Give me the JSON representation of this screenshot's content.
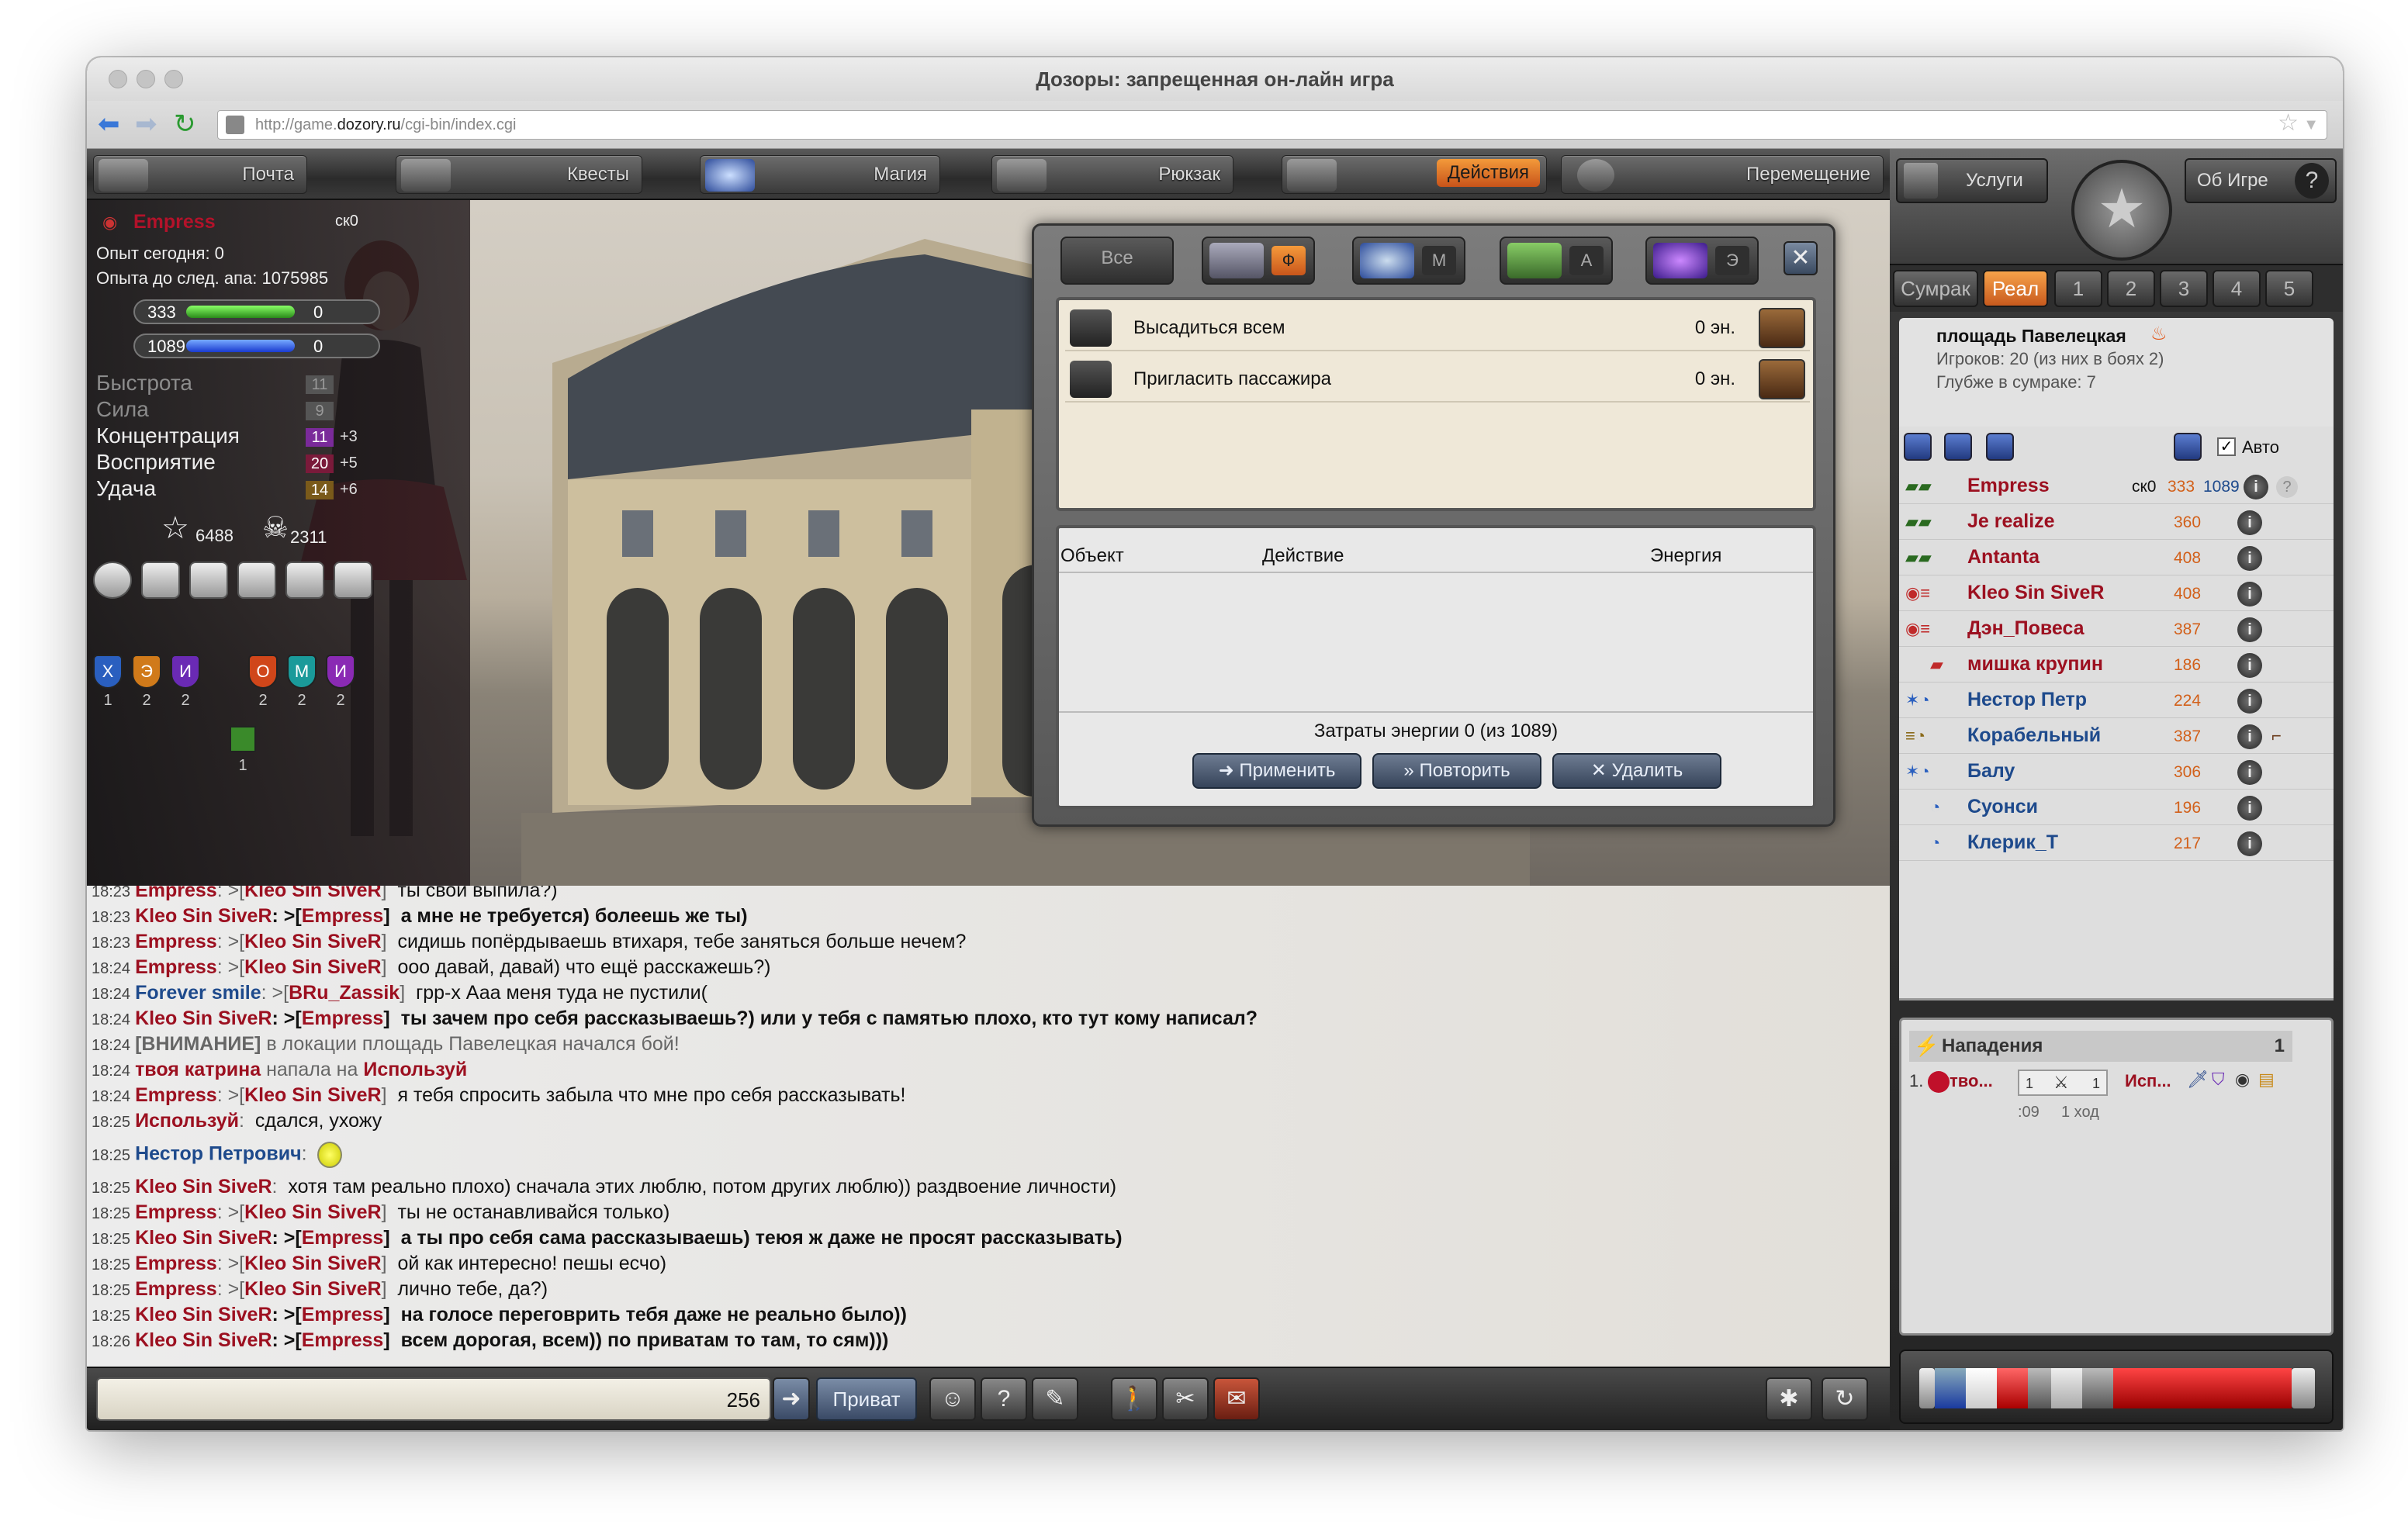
{
  "browser": {
    "title": "Дозоры: запрещенная он-лайн игра",
    "url_prefix": "http://game.",
    "url_domain": "dozory.ru",
    "url_suffix": "/cgi-bin/index.cgi"
  },
  "topnav": [
    {
      "label": "Почта",
      "active": false
    },
    {
      "label": "Квесты",
      "active": false
    },
    {
      "label": "Магия",
      "active": false
    },
    {
      "label": "Рюкзак",
      "active": false
    },
    {
      "label": "Действия",
      "active": true
    },
    {
      "label": "Перемещение",
      "active": false
    }
  ],
  "character": {
    "name": "Empress",
    "tag": "ск0",
    "exp_today": "Опыт сегодня: 0",
    "exp_next": "Опыта до след. апа: 1075985",
    "hp_value": "333",
    "hp_extra": "0",
    "mana_value": "1089",
    "mana_extra": "0",
    "stats": [
      {
        "name": "Быстрота",
        "value": "11",
        "bonus": "",
        "dim": true
      },
      {
        "name": "Сила",
        "value": "9",
        "bonus": "",
        "dim": true
      },
      {
        "name": "Концентрация",
        "value": "11",
        "bonus": "+3",
        "dim": false
      },
      {
        "name": "Восприятие",
        "value": "20",
        "bonus": "+5",
        "dim": false
      },
      {
        "name": "Удача",
        "value": "14",
        "bonus": "+6",
        "dim": false
      }
    ],
    "stars": "6488",
    "skulls": "2311",
    "shields": [
      {
        "letter": "Х",
        "count": "1",
        "color": "#2a5fbf"
      },
      {
        "letter": "Э",
        "count": "2",
        "color": "#d07a1a"
      },
      {
        "letter": "И",
        "count": "2",
        "color": "#6a2ab4"
      },
      {
        "letter": "О",
        "count": "2",
        "color": "#d0461a"
      },
      {
        "letter": "М",
        "count": "2",
        "color": "#1a9a9a"
      },
      {
        "letter": "И",
        "count": "2",
        "color": "#8a2ab4"
      }
    ],
    "extra_badge": "1"
  },
  "dialog": {
    "tabs": [
      {
        "label": "Все",
        "letter": ""
      },
      {
        "label": "",
        "letter": "Ф"
      },
      {
        "label": "",
        "letter": "М"
      },
      {
        "label": "",
        "letter": "А"
      },
      {
        "label": "",
        "letter": "Э"
      }
    ],
    "actions": [
      {
        "text": "Высадиться всем",
        "energy": "0 эн."
      },
      {
        "text": "Пригласить пассажира",
        "energy": "0 эн."
      }
    ],
    "col_object": "Объект",
    "col_action": "Действие",
    "col_energy": "Энергия",
    "cost": "Затраты энергии 0 (из 1089)",
    "btn_apply": "Применить",
    "btn_repeat": "Повторить",
    "btn_delete": "Удалить"
  },
  "chat": [
    {
      "time": "18:23",
      "from": "Empress",
      "from_color": "red",
      "bold": false,
      "private": false,
      "to": "Kleo Sin SiveR",
      "to_color": "red",
      "text": "ты свои выпила?)"
    },
    {
      "time": "18:23",
      "from": "Kleo Sin SiveR",
      "from_color": "red",
      "bold": true,
      "private": true,
      "to": "Empress",
      "to_color": "red",
      "text": "а мне не требуется) болеешь же ты)"
    },
    {
      "time": "18:23",
      "from": "Empress",
      "from_color": "red",
      "bold": false,
      "private": false,
      "to": "Kleo Sin SiveR",
      "to_color": "red",
      "text": "сидишь попёрдываешь втихаря, тебе заняться больше нечем?"
    },
    {
      "time": "18:24",
      "from": "Empress",
      "from_color": "red",
      "bold": false,
      "private": false,
      "to": "Kleo Sin SiveR",
      "to_color": "red",
      "text": "ооо давай, давай) что ещё расскажешь?)"
    },
    {
      "time": "18:24",
      "from": "Forever smile",
      "from_color": "blu",
      "bold": false,
      "private": false,
      "to": "BRu_Zassik",
      "to_color": "red",
      "text": "грр-х Ааа меня туда не пустили("
    },
    {
      "time": "18:24",
      "from": "Kleo Sin SiveR",
      "from_color": "red",
      "bold": true,
      "private": true,
      "to": "Empress",
      "to_color": "red",
      "text": "ты зачем про себя рассказываешь?) или у тебя с памятью плохо, кто тут кому написал?"
    },
    {
      "time": "18:24",
      "system": "[ВНИМАНИЕ]",
      "text": "в локации площадь Павелецкая начался бой!"
    },
    {
      "time": "18:24",
      "attack_a": "твоя катрина",
      "attack_mid": "напала на",
      "attack_b": "Используй"
    },
    {
      "time": "18:24",
      "from": "Empress",
      "from_color": "red",
      "bold": false,
      "private": false,
      "to": "Kleo Sin SiveR",
      "to_color": "red",
      "text": "я тебя спросить забыла что мне про себя рассказывать!"
    },
    {
      "time": "18:25",
      "from": "Используй",
      "from_color": "red",
      "bold": false,
      "private": false,
      "to": "",
      "to_color": "",
      "text": "сдался, ухожу"
    },
    {
      "time": "18:25",
      "from": "Нестор Петрович",
      "from_color": "blu",
      "bold": false,
      "private": false,
      "to": "",
      "to_color": "",
      "text": "",
      "smiley": true
    },
    {
      "time": "18:25",
      "from": "Kleo Sin SiveR",
      "from_color": "red",
      "bold": false,
      "private": false,
      "to": "",
      "to_color": "",
      "text": "хотя там реально плохо) сначала этих люблю, потом других люблю)) раздвоение личности)"
    },
    {
      "time": "18:25",
      "from": "Empress",
      "from_color": "red",
      "bold": false,
      "private": false,
      "to": "Kleo Sin SiveR",
      "to_color": "red",
      "text": "ты не останавливайся только)"
    },
    {
      "time": "18:25",
      "from": "Kleo Sin SiveR",
      "from_color": "red",
      "bold": true,
      "private": true,
      "to": "Empress",
      "to_color": "red",
      "text": "а ты про себя сама рассказываешь) теюя ж даже не просят рассказывать)"
    },
    {
      "time": "18:25",
      "from": "Empress",
      "from_color": "red",
      "bold": false,
      "private": false,
      "to": "Kleo Sin SiveR",
      "to_color": "red",
      "text": "ой как интересно! пешы есчо)"
    },
    {
      "time": "18:25",
      "from": "Empress",
      "from_color": "red",
      "bold": false,
      "private": false,
      "to": "Kleo Sin SiveR",
      "to_color": "red",
      "text": "лично тебе, да?)"
    },
    {
      "time": "18:25",
      "from": "Kleo Sin SiveR",
      "from_color": "red",
      "bold": true,
      "private": true,
      "to": "Empress",
      "to_color": "red",
      "text": "на голосе переговрить тебя даже не реально было))"
    },
    {
      "time": "18:26",
      "from": "Kleo Sin SiveR",
      "from_color": "red",
      "bold": true,
      "private": true,
      "to": "Empress",
      "to_color": "red",
      "text": "всем дорогая, всем)) по приватам то там, то сям)))"
    }
  ],
  "bottombar": {
    "counter": "256",
    "private_label": "Приват"
  },
  "right": {
    "btn_services": "Услуги",
    "btn_about": "Об Игре",
    "tabs": [
      {
        "label": "Сумрак",
        "active": false
      },
      {
        "label": "Реал",
        "active": true
      },
      {
        "label": "1",
        "active": false
      },
      {
        "label": "2",
        "active": false
      },
      {
        "label": "3",
        "active": false
      },
      {
        "label": "4",
        "active": false
      },
      {
        "label": "5",
        "active": false
      }
    ],
    "location_name": "площадь Павелецкая",
    "players_info": "Игроков: 20 (из них в боях 2)",
    "depth_info": "Глубже в сумраке: 7",
    "auto_label": "Авто",
    "players": [
      {
        "name": "Empress",
        "color": "#9c1020",
        "level": "ск0",
        "hp": "333",
        "mana": "1089",
        "self": true
      },
      {
        "name": "Je realize",
        "color": "#9c1020",
        "level": "360"
      },
      {
        "name": "Antanta",
        "color": "#9c1020",
        "level": "408"
      },
      {
        "name": "Kleo Sin SiveR",
        "color": "#9c1020",
        "level": "408"
      },
      {
        "name": "Дэн_Повеса",
        "color": "#9c1020",
        "level": "387"
      },
      {
        "name": "мишка крупин",
        "color": "#9c1020",
        "level": "186"
      },
      {
        "name": "Нестор Петр",
        "color": "#1e4a8c",
        "level": "224"
      },
      {
        "name": "Корабельный",
        "color": "#1e4a8c",
        "level": "387"
      },
      {
        "name": "Балу",
        "color": "#1e4a8c",
        "level": "306"
      },
      {
        "name": "Суонси",
        "color": "#1e4a8c",
        "level": "196"
      },
      {
        "name": "Клерик_Т",
        "color": "#1e4a8c",
        "level": "217"
      }
    ],
    "attacks_title": "Нападения",
    "attacks_count": "1",
    "attack_row": {
      "num": "1.",
      "attacker": "тво...",
      "left_count": "1",
      "right_count": "1",
      "defender": "Исп...",
      "timer": ":09",
      "turn": "1 ход"
    }
  }
}
